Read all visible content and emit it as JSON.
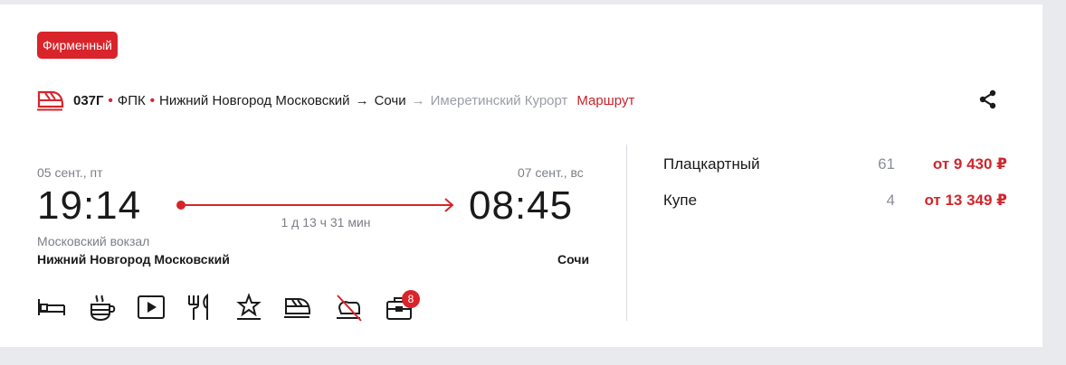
{
  "badge": "Фирменный",
  "route": {
    "train_number": "037Г",
    "carrier": "ФПК",
    "from": "Нижний Новгород Московский",
    "arrow": "→",
    "to": "Сочи",
    "arrow_grey": "→",
    "final_destination": "Имеретинский Курорт",
    "link": "Маршрут"
  },
  "departure": {
    "date": "05 сент., пт",
    "time": "19:14",
    "station_detail": "Московский вокзал",
    "station": "Нижний Новгород Московский"
  },
  "arrival": {
    "date": "07 сент., вс",
    "time": "08:45",
    "station": "Сочи"
  },
  "duration": "1 д 13 ч 31 мин",
  "amenities": {
    "extra_count": "8",
    "items": [
      "bed-icon",
      "coffee-icon",
      "video-icon",
      "restaurant-icon",
      "star-icon",
      "train-icon",
      "no-pets-icon",
      "luggage-icon"
    ]
  },
  "fares": [
    {
      "class": "Плацкартный",
      "seats": "61",
      "price": "от 9 430 ₽"
    },
    {
      "class": "Купе",
      "seats": "4",
      "price": "от 13 349 ₽"
    }
  ],
  "colors": {
    "accent": "#d8242a",
    "price": "#d0262c",
    "muted": "#7b7f87",
    "background": "#e9eaee"
  }
}
